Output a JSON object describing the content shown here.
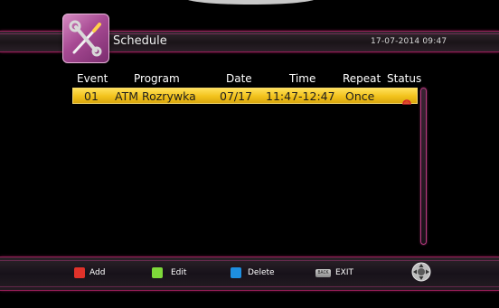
{
  "window": {
    "title": "Schedule",
    "datetime": "17-07-2014 09:47"
  },
  "app_icon": "tools-icon",
  "table": {
    "columns": [
      "Event",
      "Program",
      "Date",
      "Time",
      "Repeat",
      "Status"
    ],
    "rows": [
      {
        "event": "01",
        "program": "ATM Rozrywka",
        "date": "07/17",
        "time": "11:47-12:47",
        "repeat": "Once",
        "status_icon": "record-icon",
        "selected": true
      }
    ]
  },
  "footer": {
    "add": {
      "label": "Add",
      "color": "#e0322a"
    },
    "edit": {
      "label": "Edit",
      "color": "#7ed83a"
    },
    "delete": {
      "label": "Delete",
      "color": "#1e8fe0"
    },
    "exit": {
      "label": "EXIT",
      "key": "BACK"
    },
    "nav_icon": "dpad-icon"
  },
  "colors": {
    "accent": "#9b1f5a",
    "selection": "#f2c21b",
    "status_icon": "#d8242a"
  }
}
